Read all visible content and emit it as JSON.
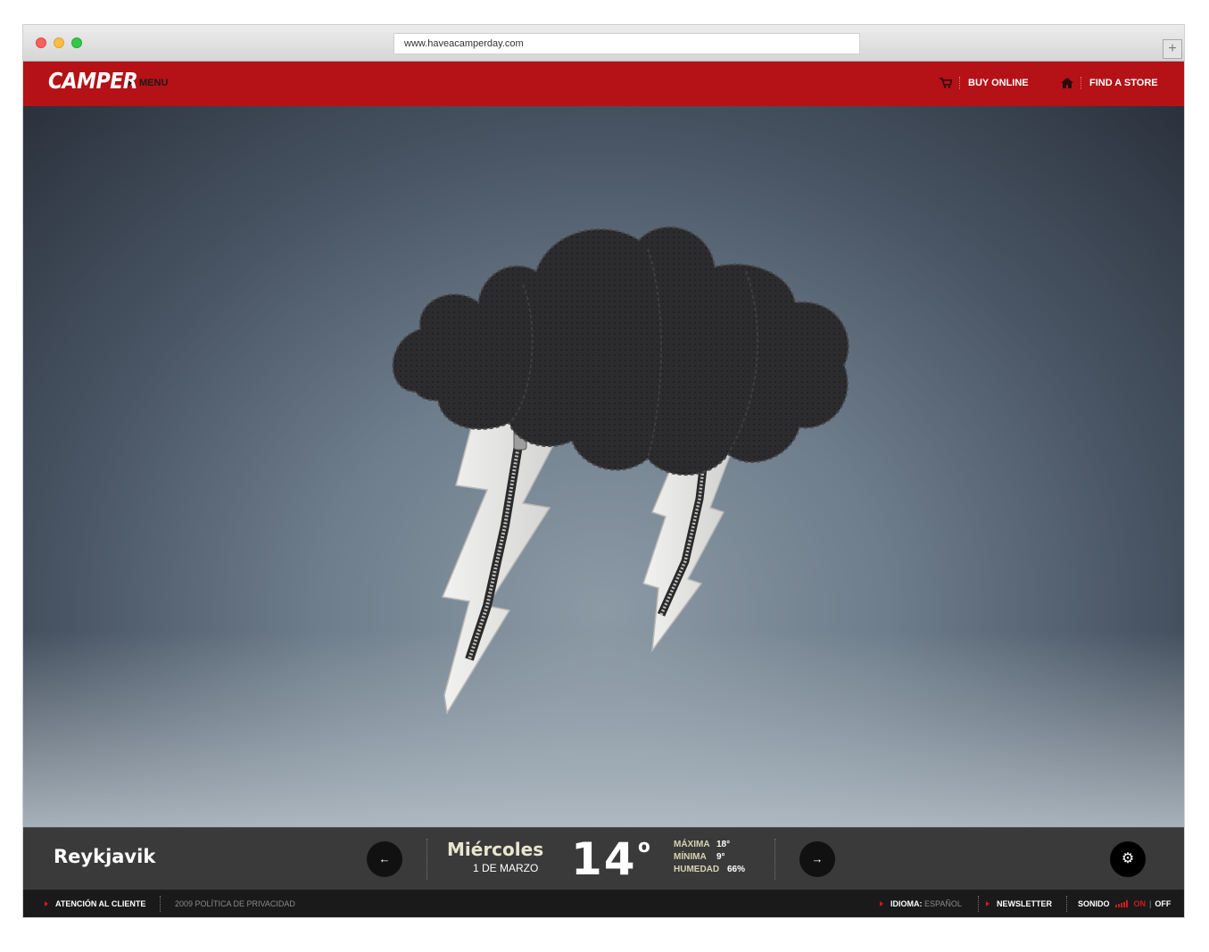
{
  "browser": {
    "url": "www.haveacamperday.com",
    "new_tab_label": "+"
  },
  "header": {
    "logo": "CAMPER",
    "menu_label": "MENU",
    "buy_online": "BUY ONLINE",
    "find_store": "FIND A STORE"
  },
  "weather": {
    "city": "Reykjavik",
    "day": "Miércoles",
    "date": "1 DE MARZO",
    "temperature": "14",
    "degree_symbol": "o",
    "max_label": "MÁXIMA",
    "max_value": "18°",
    "min_label": "MÍNIMA",
    "min_value": "9°",
    "humidity_label": "HUMEDAD",
    "humidity_value": "66%",
    "prev_arrow": "←",
    "next_arrow": "→",
    "settings_icon": "⚙"
  },
  "footer": {
    "customer_service": "ATENCIÓN AL CLIENTE",
    "privacy": "2009 POLÍTICA DE PRIVACIDAD",
    "language_label": "IDIOMA:",
    "language_value": "ESPAÑOL",
    "newsletter": "NEWSLETTER",
    "sound_label": "SONIDO",
    "sound_on": "ON",
    "sound_divider": "|",
    "sound_off": "OFF"
  },
  "colors": {
    "brand_red": "#b41216",
    "footer_bg": "#1a1a1a",
    "weather_bar_bg": "#3a3a3a",
    "accent_cream": "#e9e6cf"
  }
}
